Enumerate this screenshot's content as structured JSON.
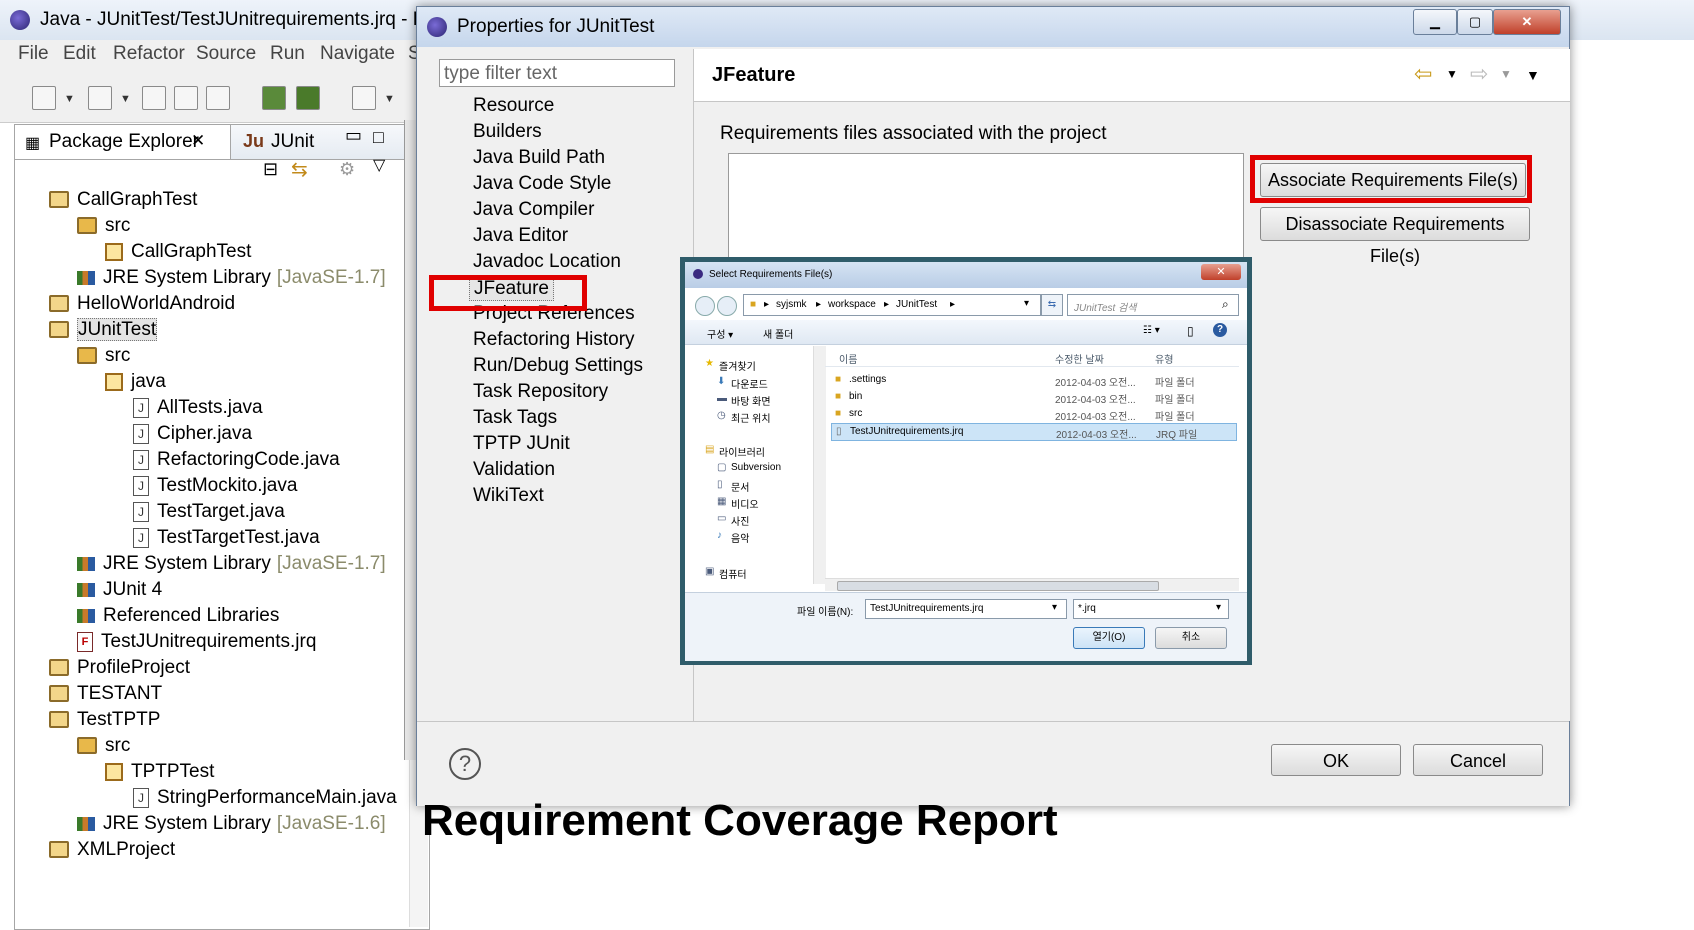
{
  "eclipse": {
    "title": "Java - JUnitTest/TestJUnitrequirements.jrq - Eclip",
    "menu": [
      "File",
      "Edit",
      "Refactor",
      "Source",
      "Run",
      "Navigate",
      "S"
    ],
    "package_explorer_tab": "Package Explorer",
    "junit_tab": "JUnit",
    "tree": [
      {
        "label": "CallGraphTest",
        "icon": "project-icon",
        "extra": ""
      },
      {
        "label": "src",
        "icon": "source-folder-icon",
        "extra": ""
      },
      {
        "label": "CallGraphTest",
        "icon": "package-icon",
        "extra": ""
      },
      {
        "label": "JRE System Library",
        "icon": "library-icon",
        "extra": "[JavaSE-1.7]"
      },
      {
        "label": "HelloWorldAndroid",
        "icon": "project-icon",
        "extra": ""
      },
      {
        "label": "JUnitTest",
        "icon": "project-icon",
        "extra": ""
      },
      {
        "label": "src",
        "icon": "source-folder-icon",
        "extra": ""
      },
      {
        "label": "java",
        "icon": "package-icon",
        "extra": ""
      },
      {
        "label": "AllTests.java",
        "icon": "java-file-icon",
        "extra": ""
      },
      {
        "label": "Cipher.java",
        "icon": "java-file-icon",
        "extra": ""
      },
      {
        "label": "RefactoringCode.java",
        "icon": "java-file-icon",
        "extra": ""
      },
      {
        "label": "TestMockito.java",
        "icon": "java-file-icon",
        "extra": ""
      },
      {
        "label": "TestTarget.java",
        "icon": "java-file-icon",
        "extra": ""
      },
      {
        "label": "TestTargetTest.java",
        "icon": "java-file-icon",
        "extra": ""
      },
      {
        "label": "JRE System Library",
        "icon": "library-icon",
        "extra": "[JavaSE-1.7]"
      },
      {
        "label": "JUnit 4",
        "icon": "library-icon",
        "extra": ""
      },
      {
        "label": "Referenced Libraries",
        "icon": "library-icon",
        "extra": ""
      },
      {
        "label": "TestJUnitrequirements.jrq",
        "icon": "jrq-file-icon",
        "extra": ""
      },
      {
        "label": "ProfileProject",
        "icon": "project-icon",
        "extra": ""
      },
      {
        "label": "TESTANT",
        "icon": "project-icon",
        "extra": ""
      },
      {
        "label": "TestTPTP",
        "icon": "project-icon",
        "extra": ""
      },
      {
        "label": "src",
        "icon": "source-folder-icon",
        "extra": ""
      },
      {
        "label": "TPTPTest",
        "icon": "package-icon",
        "extra": ""
      },
      {
        "label": "StringPerformanceMain.java",
        "icon": "java-file-icon",
        "extra": ""
      },
      {
        "label": "JRE System Library",
        "icon": "library-icon",
        "extra": "[JavaSE-1.6]"
      },
      {
        "label": "XMLProject",
        "icon": "project-icon",
        "extra": ""
      }
    ]
  },
  "properties": {
    "title": "Properties for JUnitTest",
    "filter_placeholder": "type filter text",
    "nav": [
      "Resource",
      "Builders",
      "Java Build Path",
      "Java Code Style",
      "Java Compiler",
      "Java Editor",
      "Javadoc Location",
      "JFeature",
      "Project References",
      "Refactoring History",
      "Run/Debug Settings",
      "Task Repository",
      "Task Tags",
      "TPTP JUnit",
      "Validation",
      "WikiText"
    ],
    "heading": "JFeature",
    "desc": "Requirements files associated with the project",
    "associate_btn": "Associate Requirements File(s)",
    "disassociate_btn": "Disassociate Requirements File(s)",
    "help": "?",
    "ok": "OK",
    "cancel": "Cancel"
  },
  "select_dialog": {
    "title": "Select Requirements File(s)",
    "path": [
      "syjsmk",
      "workspace",
      "JUnitTest"
    ],
    "search_placeholder": "JUnitTest 검색",
    "organize": "구성 ▾",
    "new_folder": "새 폴더",
    "sidebar": [
      "즐겨찾기",
      "다운로드",
      "바탕 화면",
      "최근 위치",
      "라이브러리",
      "Subversion",
      "문서",
      "비디오",
      "사진",
      "음악",
      "컴퓨터"
    ],
    "columns": [
      "이름",
      "수정한 날짜",
      "유형"
    ],
    "files": [
      {
        "name": ".settings",
        "date": "2012-04-03 오전...",
        "type": "파일 폴더"
      },
      {
        "name": "bin",
        "date": "2012-04-03 오전...",
        "type": "파일 폴더"
      },
      {
        "name": "src",
        "date": "2012-04-03 오전...",
        "type": "파일 폴더"
      },
      {
        "name": "TestJUnitrequirements.jrq",
        "date": "2012-04-03 오전...",
        "type": "JRQ 파일"
      }
    ],
    "filename_label": "파일 이름(N):",
    "filename": "TestJUnitrequirements.jrq",
    "filter": "*.jrq",
    "open": "열기(O)",
    "cancel": "취소"
  },
  "footer_title": "Requirement Coverage Report"
}
